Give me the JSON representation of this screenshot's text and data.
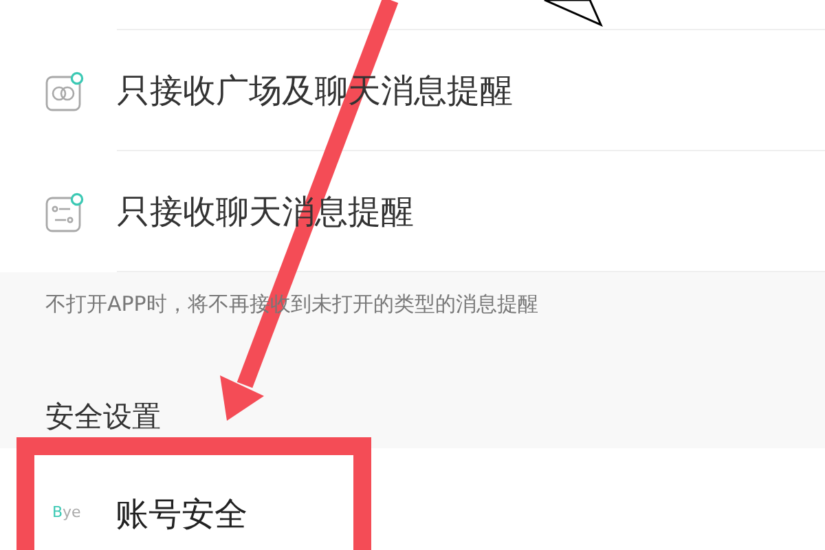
{
  "notification_options": [
    {
      "kind": "square",
      "label": "只接收广场及聊天消息提醒",
      "badge": true
    },
    {
      "kind": "chat",
      "label": "只接收聊天消息提醒",
      "badge": true
    }
  ],
  "note": "不打开APP时，将不再接收到未打开的类型的消息提醒",
  "section_title": "安全设置",
  "security_items": [
    {
      "logo_accent": "B",
      "logo_rest": "ye",
      "label": "账号安全",
      "highlighted": true
    }
  ]
}
